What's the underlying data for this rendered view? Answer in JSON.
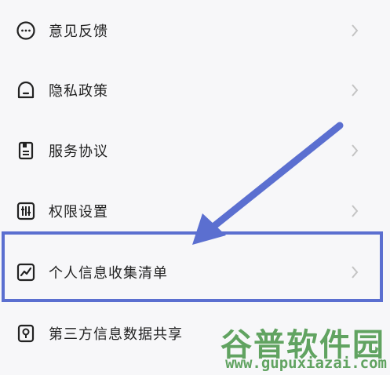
{
  "menu": {
    "items": [
      {
        "label": "意见反馈",
        "icon": "feedback-icon"
      },
      {
        "label": "隐私政策",
        "icon": "privacy-icon"
      },
      {
        "label": "服务协议",
        "icon": "agreement-icon"
      },
      {
        "label": "权限设置",
        "icon": "permission-settings-icon"
      },
      {
        "label": "个人信息收集清单",
        "icon": "personal-info-icon"
      },
      {
        "label": "第三方信息数据共享",
        "icon": "third-party-share-icon"
      }
    ]
  },
  "watermark": {
    "name": "谷普软件园",
    "url": "www.gupuxiazai.com"
  },
  "colors": {
    "background": "#f7f7f9",
    "text": "#222222",
    "chevron": "#c4c4c4",
    "annotation": "#5b6fd0",
    "watermark": "#3c8f3c"
  }
}
